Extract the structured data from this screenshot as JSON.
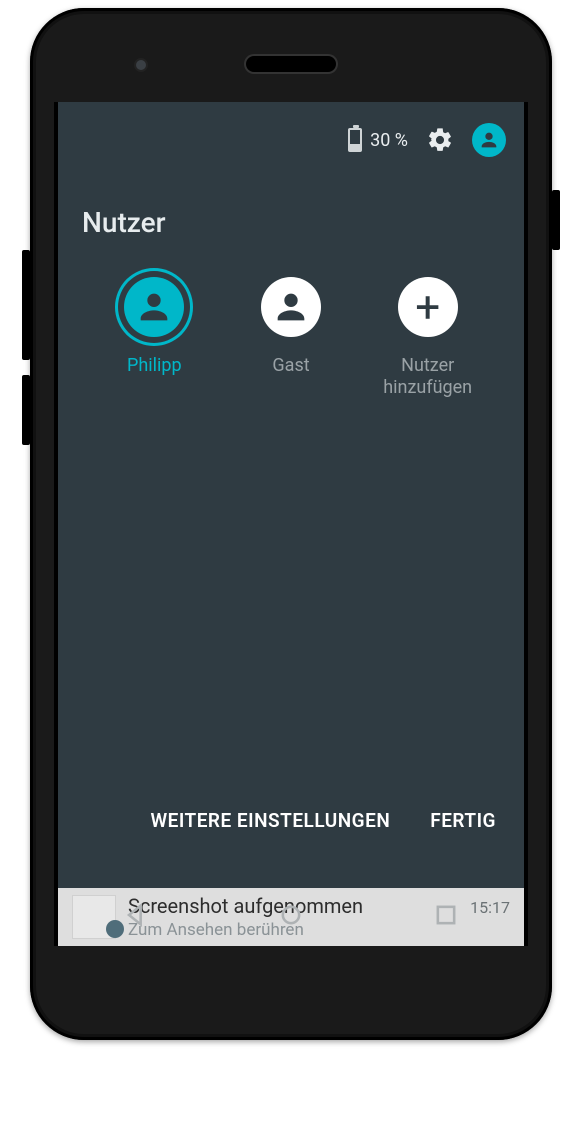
{
  "status": {
    "battery_pct": "30 %"
  },
  "panel": {
    "title": "Nutzer",
    "users": [
      {
        "label": "Philipp",
        "active": true
      },
      {
        "label": "Gast",
        "active": false
      },
      {
        "label": "Nutzer\nhinzufügen",
        "active": false
      }
    ],
    "actions": {
      "more": "WEITERE EINSTELLUNGEN",
      "done": "FERTIG"
    }
  },
  "notification": {
    "title": "Screenshot aufgenommen",
    "subtitle": "Zum Ansehen berühren",
    "time": "15:17"
  }
}
